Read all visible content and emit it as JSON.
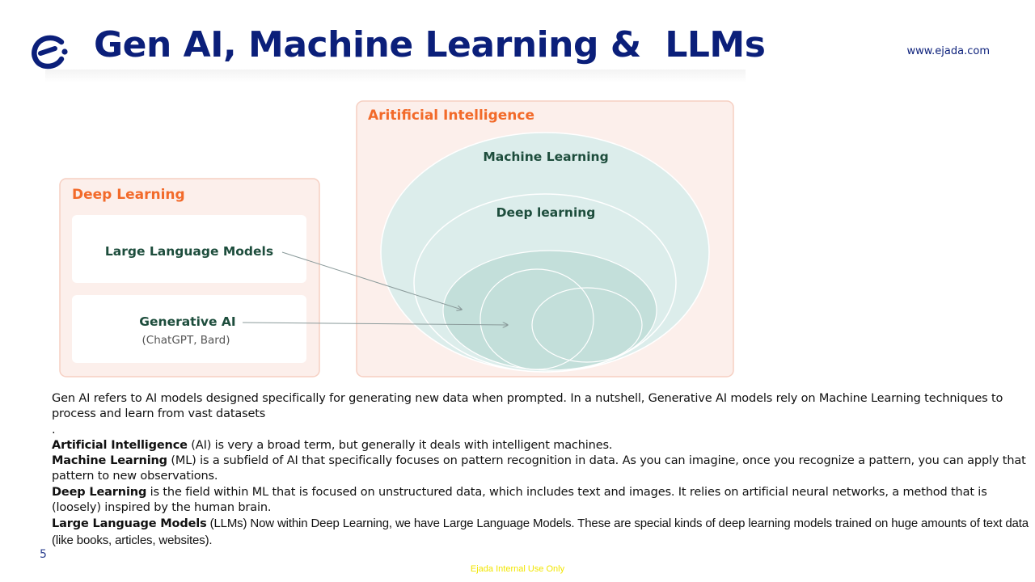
{
  "header": {
    "title": "Gen AI, Machine Learning &  LLMs",
    "website": "www.ejada.com"
  },
  "diagram": {
    "ai_panel_label": "Aritificial Intelligence",
    "ml_label": "Machine Learning",
    "dl_inner_label": "Deep learning",
    "dl_panel_label": "Deep Learning",
    "llm_card_label": "Large Language Models",
    "genai_card_label": "Generative AI",
    "genai_card_sublabel": "(ChatGPT, Bard)"
  },
  "body": {
    "intro": "Gen AI refers to AI models designed specifically for generating new data when prompted. In a nutshell, Generative AI models rely on Machine Learning techniques to process and learn from vast datasets",
    "intro_dot": ".",
    "ai_term": "Artificial Intelligence",
    "ai_text": " (AI) is very a broad term, but generally it deals with intelligent machines.",
    "ml_term": "Machine Learning",
    "ml_text": " (ML) is a subfield of AI that specifically focuses on pattern recognition in data. As you can imagine, once you recognize a pattern, you can apply that pattern to new observations.",
    "dl_term": "Deep Learning",
    "dl_text": " is the field within ML that is focused on unstructured data, which includes text and images. It relies on artificial neural networks, a method that is (loosely) inspired by the human brain.",
    "llm_term": "Large Language Models",
    "llm_text_a": " (LLMs)",
    "llm_text_b": " Now within Deep Learning, we have Large Language Models. These are special kinds of deep learning models trained on huge amounts of text data (like books, articles, websites)."
  },
  "footer": {
    "page_number": "5",
    "classification": "Ejada Internal Use Only"
  },
  "colors": {
    "brand_navy": "#0b1f7a",
    "accent_orange": "#f26a2a",
    "label_green": "#1d4d3c",
    "panel_fill": "#fcefeb",
    "panel_border": "#f6cfc2",
    "ellipse_light": "#dcedeb",
    "ellipse_mid": "#c3dfda"
  }
}
